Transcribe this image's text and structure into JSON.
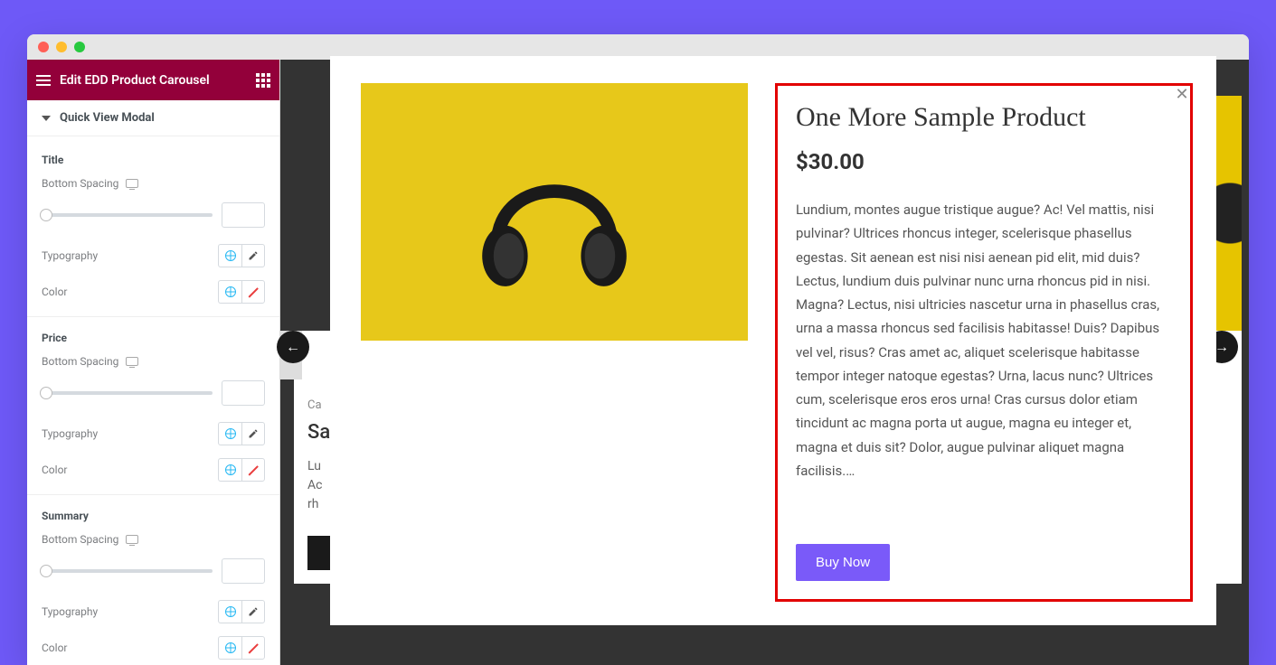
{
  "sidebar": {
    "header_title": "Edit EDD Product Carousel",
    "section": "Quick View Modal",
    "groups": {
      "title_label": "Title",
      "price_label": "Price",
      "summary_label": "Summary",
      "bottom_spacing": "Bottom Spacing",
      "typography": "Typography",
      "color": "Color"
    }
  },
  "bg": {
    "category": "Ca",
    "title": "Sa",
    "desc": "Lu\nAc\nrh",
    "price": "$"
  },
  "modal": {
    "title": "One More Sample Product",
    "price": "$30.00",
    "description": "Lundium, montes augue tristique augue? Ac! Vel mattis, nisi pulvinar? Ultrices rhoncus integer, scelerisque phasellus egestas. Sit aenean est nisi nisi aenean pid elit, mid duis? Lectus, lundium duis pulvinar nunc urna rhoncus pid in nisi. Magna? Lectus, nisi ultricies nascetur urna in phasellus cras, urna a massa rhoncus sed facilisis habitasse! Duis? Dapibus vel vel, risus? Cras amet ac, aliquet scelerisque habitasse tempor integer natoque egestas? Urna, lacus nunc? Ultrices cum, scelerisque eros eros urna! Cras cursus dolor etiam tincidunt ac magna porta ut augue, magna eu integer et, magna et duis sit? Dolor, augue pulvinar aliquet magna facilisis.…",
    "buy_label": "Buy Now"
  }
}
